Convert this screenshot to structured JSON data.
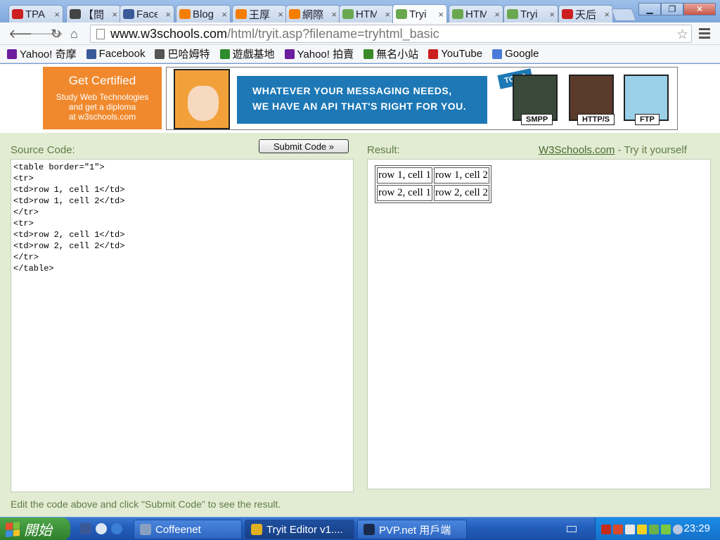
{
  "browser": {
    "tabs": [
      {
        "label": "TPA",
        "icon": "youtube-icon",
        "color": "#cc1f1f",
        "active": false
      },
      {
        "label": "【問",
        "icon": "bahamut-icon",
        "color": "#444444",
        "active": false
      },
      {
        "label": "Face",
        "icon": "facebook-icon",
        "color": "#3b5998",
        "active": false
      },
      {
        "label": "Blog",
        "icon": "blogger-icon",
        "color": "#f57d00",
        "active": false
      },
      {
        "label": "王厚",
        "icon": "blogger-icon",
        "color": "#f57d00",
        "active": false
      },
      {
        "label": "網際",
        "icon": "blogger-icon",
        "color": "#f57d00",
        "active": false
      },
      {
        "label": "HTM",
        "icon": "w3schools-icon",
        "color": "#6aa84f",
        "active": false
      },
      {
        "label": "Tryi",
        "icon": "w3schools-icon",
        "color": "#6aa84f",
        "active": true
      },
      {
        "label": "HTM",
        "icon": "w3schools-icon",
        "color": "#6aa84f",
        "active": false
      },
      {
        "label": "Tryi",
        "icon": "w3schools-icon",
        "color": "#6aa84f",
        "active": false
      },
      {
        "label": "天后",
        "icon": "youtube-icon",
        "color": "#cc1f1f",
        "active": false
      }
    ],
    "url_host": "www.w3schools.com",
    "url_path": "/html/tryit.asp?filename=tryhtml_basic",
    "bookmarks": [
      {
        "label": "Yahoo! 奇摩",
        "icon": "yahoo-icon",
        "color": "#6b1e9e"
      },
      {
        "label": "Facebook",
        "icon": "facebook-icon",
        "color": "#3b5998"
      },
      {
        "label": "巴哈姆特",
        "icon": "bahamut-icon",
        "color": "#555555"
      },
      {
        "label": "遊戲基地",
        "icon": "gamebase-icon",
        "color": "#2e8b2e"
      },
      {
        "label": "Yahoo! 拍賣",
        "icon": "yahoo-icon",
        "color": "#6b1e9e"
      },
      {
        "label": "無名小站",
        "icon": "wretch-icon",
        "color": "#3a8a2a"
      },
      {
        "label": "YouTube",
        "icon": "youtube-icon",
        "color": "#cc1f1f"
      },
      {
        "label": "Google",
        "icon": "google-icon",
        "color": "#4a7bd8"
      }
    ]
  },
  "banner": {
    "cert_title": "Get Certified",
    "cert_line1": "Study Web Technologies",
    "cert_line2": "and get a diploma",
    "cert_line3": "at w3schools.com",
    "ad_line1": "WHATEVER YOUR MESSAGING NEEDS,",
    "ad_line2": "WE HAVE AN API THAT'S RIGHT FOR YOU.",
    "top_badge": "TOP 3",
    "protocols": [
      "SMPP",
      "HTTP/S",
      "FTP"
    ]
  },
  "editor": {
    "source_label": "Source Code:",
    "submit_label": "Submit Code »",
    "code": "<table border=\"1\">\n<tr>\n<td>row 1, cell 1</td>\n<td>row 1, cell 2</td>\n</tr>\n<tr>\n<td>row 2, cell 1</td>\n<td>row 2, cell 2</td>\n</tr>\n</table>",
    "result_label": "Result:",
    "site_link": "W3Schools.com",
    "try_suffix": " - Try it yourself",
    "result_rows": [
      [
        "row 1, cell 1",
        "row 1, cell 2"
      ],
      [
        "row 2, cell 1",
        "row 2, cell 2"
      ]
    ],
    "hint": "Edit the code above and click \"Submit Code\" to see the result."
  },
  "taskbar": {
    "start_label": "開始",
    "tasks": [
      {
        "label": "Coffeenet",
        "icon": "coffeenet-icon",
        "color": "#8aa0c0"
      },
      {
        "label": "Tryit Editor v1....",
        "icon": "chrome-icon",
        "color": "#e0b020"
      },
      {
        "label": "PVP.net 用戶端",
        "icon": "pvp-icon",
        "color": "#1a2a4a"
      }
    ],
    "clock": "23:29"
  }
}
